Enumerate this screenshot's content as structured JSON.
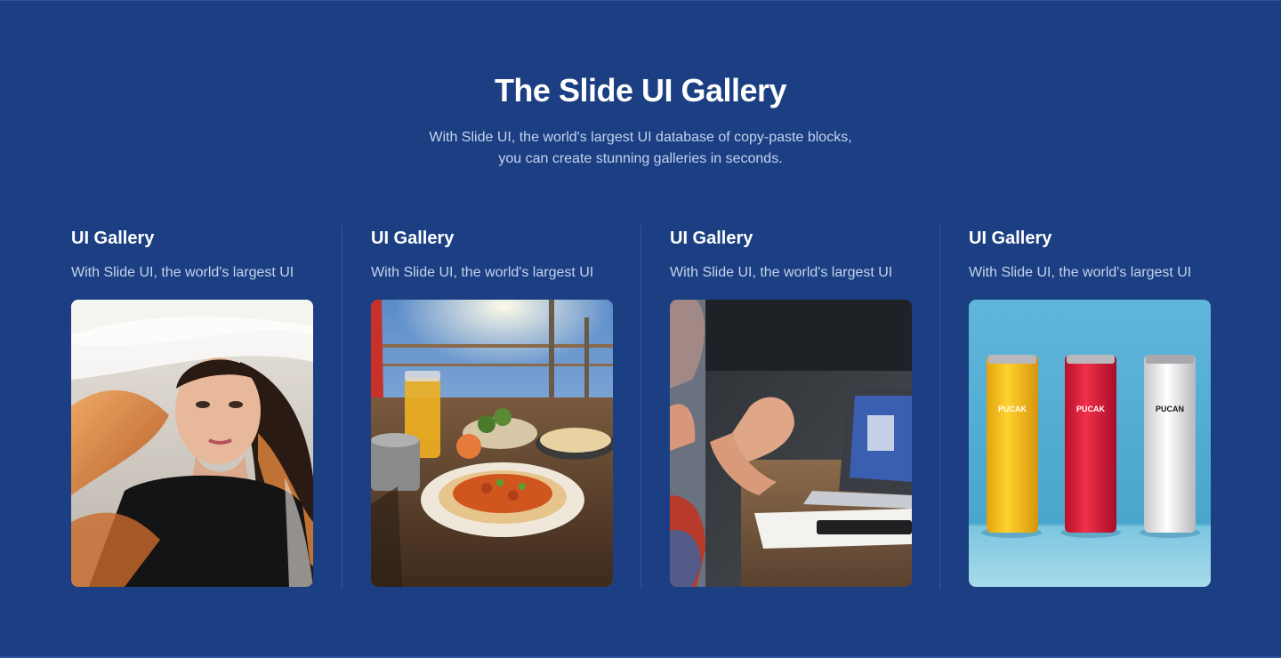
{
  "hero": {
    "title": "The Slide UI Gallery",
    "subtitle_line1": "With Slide UI, the world's largest UI database of copy-paste blocks,",
    "subtitle_line2": "you can create stunning galleries in seconds."
  },
  "gallery": {
    "items": [
      {
        "title": "UI Gallery",
        "description": "With Slide UI, the world's largest UI",
        "image": "portrait-woman-wind"
      },
      {
        "title": "UI Gallery",
        "description": "With Slide UI, the world's largest UI",
        "image": "food-terrace-table"
      },
      {
        "title": "UI Gallery",
        "description": "With Slide UI, the world's largest UI",
        "image": "meeting-laptop-hands"
      },
      {
        "title": "UI Gallery",
        "description": "With Slide UI, the world's largest UI",
        "image": "three-cans-product",
        "can_labels": [
          "PUCAK",
          "PUCAK",
          "PUCAN"
        ]
      }
    ]
  },
  "colors": {
    "background": "#1b3f82",
    "heading": "#ffffff",
    "body_text": "#c3d3ee",
    "divider": "#2f5697"
  }
}
